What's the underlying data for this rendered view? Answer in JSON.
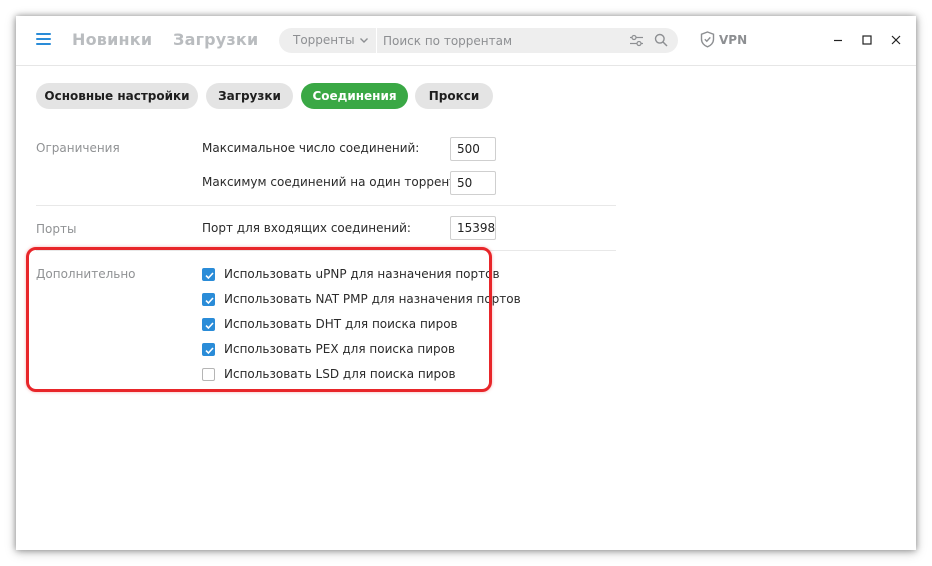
{
  "header": {
    "nav": [
      "Новинки",
      "Загрузки"
    ],
    "search": {
      "scope": "Торренты",
      "placeholder": "Поиск по торрентам"
    },
    "vpn_label": "VPN"
  },
  "tabs": [
    {
      "label": "Основные настройки",
      "active": false
    },
    {
      "label": "Загрузки",
      "active": false
    },
    {
      "label": "Соединения",
      "active": true
    },
    {
      "label": "Прокси",
      "active": false
    }
  ],
  "sections": {
    "limits": {
      "title": "Ограничения",
      "fields": [
        {
          "label": "Максимальное число соединений:",
          "value": "500"
        },
        {
          "label": "Максимум соединений на один торрент:",
          "value": "50"
        }
      ]
    },
    "ports": {
      "title": "Порты",
      "fields": [
        {
          "label": "Порт для входящих соединений:",
          "value": "15398"
        }
      ]
    },
    "advanced": {
      "title": "Дополнительно",
      "options": [
        {
          "label": "Использовать uPNP для назначения портов",
          "checked": true
        },
        {
          "label": "Использовать NAT PMP для назначения портов",
          "checked": true
        },
        {
          "label": "Использовать DHT для поиска пиров",
          "checked": true
        },
        {
          "label": "Использовать PEX для поиска пиров",
          "checked": true
        },
        {
          "label": "Использовать LSD для поиска пиров",
          "checked": false
        }
      ]
    }
  },
  "colors": {
    "accent_green": "#3aa845",
    "accent_blue": "#2a8cd8",
    "highlight_red": "#e8262a"
  }
}
